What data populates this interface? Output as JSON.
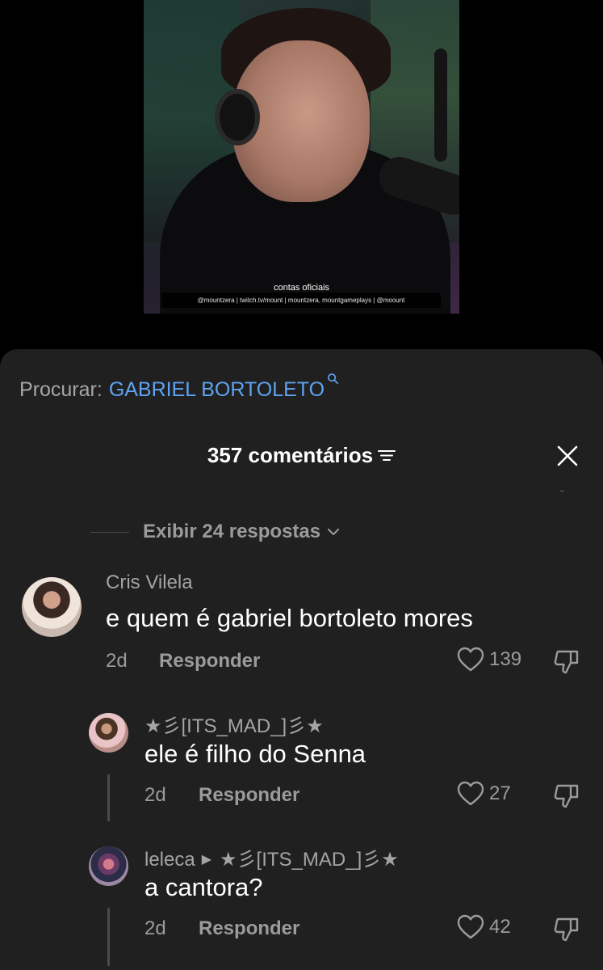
{
  "video": {
    "caption_title": "contas oficiais",
    "caption_bar": "@mountzera | twitch.tv/mount | mountzera, mountgameplays | @moount"
  },
  "search": {
    "prefix": "Procurar:",
    "term": "GABRIEL BORTOLETO"
  },
  "header": {
    "count": "357 comentários"
  },
  "view_replies": "Exibir 24 respostas",
  "reply_label": "Responder",
  "comments": [
    {
      "author": "Cris Vilela",
      "text": "e quem é gabriel bortoleto mores",
      "age": "2d",
      "likes": "139"
    },
    {
      "author": "★彡[ITS_MAD_]彡★",
      "text": "ele é filho do Senna",
      "age": "2d",
      "likes": "27"
    },
    {
      "author": "leleca",
      "reply_to": "★彡[ITS_MAD_]彡★",
      "text": "a cantora?",
      "age": "2d",
      "likes": "42"
    }
  ],
  "colors": {
    "sheet_bg": "#202020",
    "search_term": "#5ea4f2",
    "muted": "#9b9b9b"
  }
}
